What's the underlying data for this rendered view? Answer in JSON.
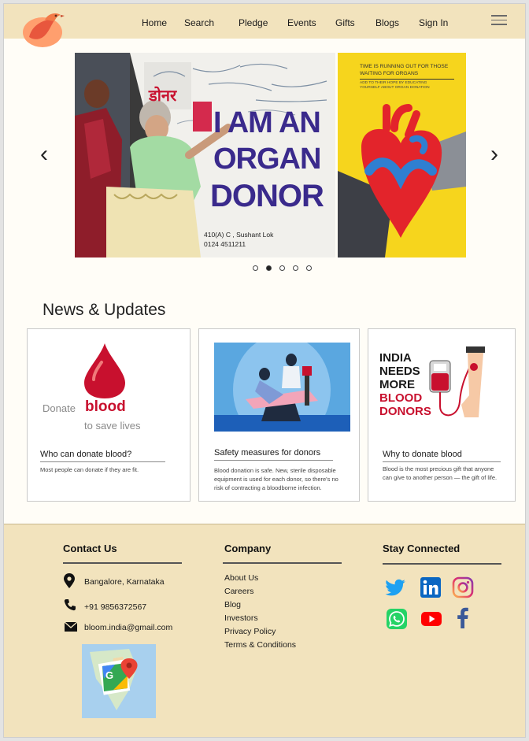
{
  "nav": {
    "home": "Home",
    "search": "Search",
    "pledge": "Pledge",
    "events": "Events",
    "gifts": "Gifts",
    "blogs": "Blogs",
    "signin": "Sign In"
  },
  "carousel": {
    "slide1": {
      "banner_hindi": "डोनर",
      "banner_line1": "I AM AN",
      "banner_line2": "ORGAN",
      "banner_line3": "DONOR",
      "address_line1": "410(A) C , Sushant Lok",
      "address_line2": "0124 4511211"
    },
    "slide2": {
      "headline": "TIME IS RUNNING OUT FOR THOSE WAITING FOR ORGANS",
      "subline": "ADD TO THEIR HOPE BY EDUCATING YOURSELF ABOUT ORGAN DONATION"
    },
    "prev_icon": "‹",
    "next_icon": "›",
    "dot_count": 5,
    "active_dot": 2
  },
  "news": {
    "heading": "News & Updates",
    "cards": [
      {
        "image_text_1": "Donate",
        "image_text_2": "blood",
        "image_text_3": "to save lives",
        "title": "Who can donate blood?",
        "text": "Most people can donate if they are fit."
      },
      {
        "title": "Safety measures for donors",
        "text": "Blood donation is safe. New, sterile disposable equipment is used for each donor, so there's no risk of contracting a bloodborne infection."
      },
      {
        "image_text_1": "INDIA",
        "image_text_2": "NEEDS",
        "image_text_3": "MORE",
        "image_text_4": "BLOOD",
        "image_text_5": "DONORS",
        "title": "Why to donate blood",
        "text": "Blood is the most precious gift that anyone can give to another person — the gift of life."
      }
    ]
  },
  "footer": {
    "contact_heading": "Contact Us",
    "address": "Bangalore, Karnataka",
    "phone": "+91 9856372567",
    "email": "bloom.india@gmail.com",
    "company_heading": "Company",
    "company_links": [
      "About Us",
      "Careers",
      "Blog",
      "Investors",
      "Privacy Policy",
      "Terms & Conditions"
    ],
    "stay_heading": "Stay Connected",
    "social_icons": [
      "twitter-icon",
      "linkedin-icon",
      "instagram-icon",
      "whatsapp-icon",
      "youtube-icon",
      "facebook-icon"
    ]
  },
  "colors": {
    "header_bg": "#f2e3bd",
    "footer_bg": "#f2e3bd",
    "blood_red": "#c8102e",
    "poster_yellow": "#f6d51d"
  }
}
